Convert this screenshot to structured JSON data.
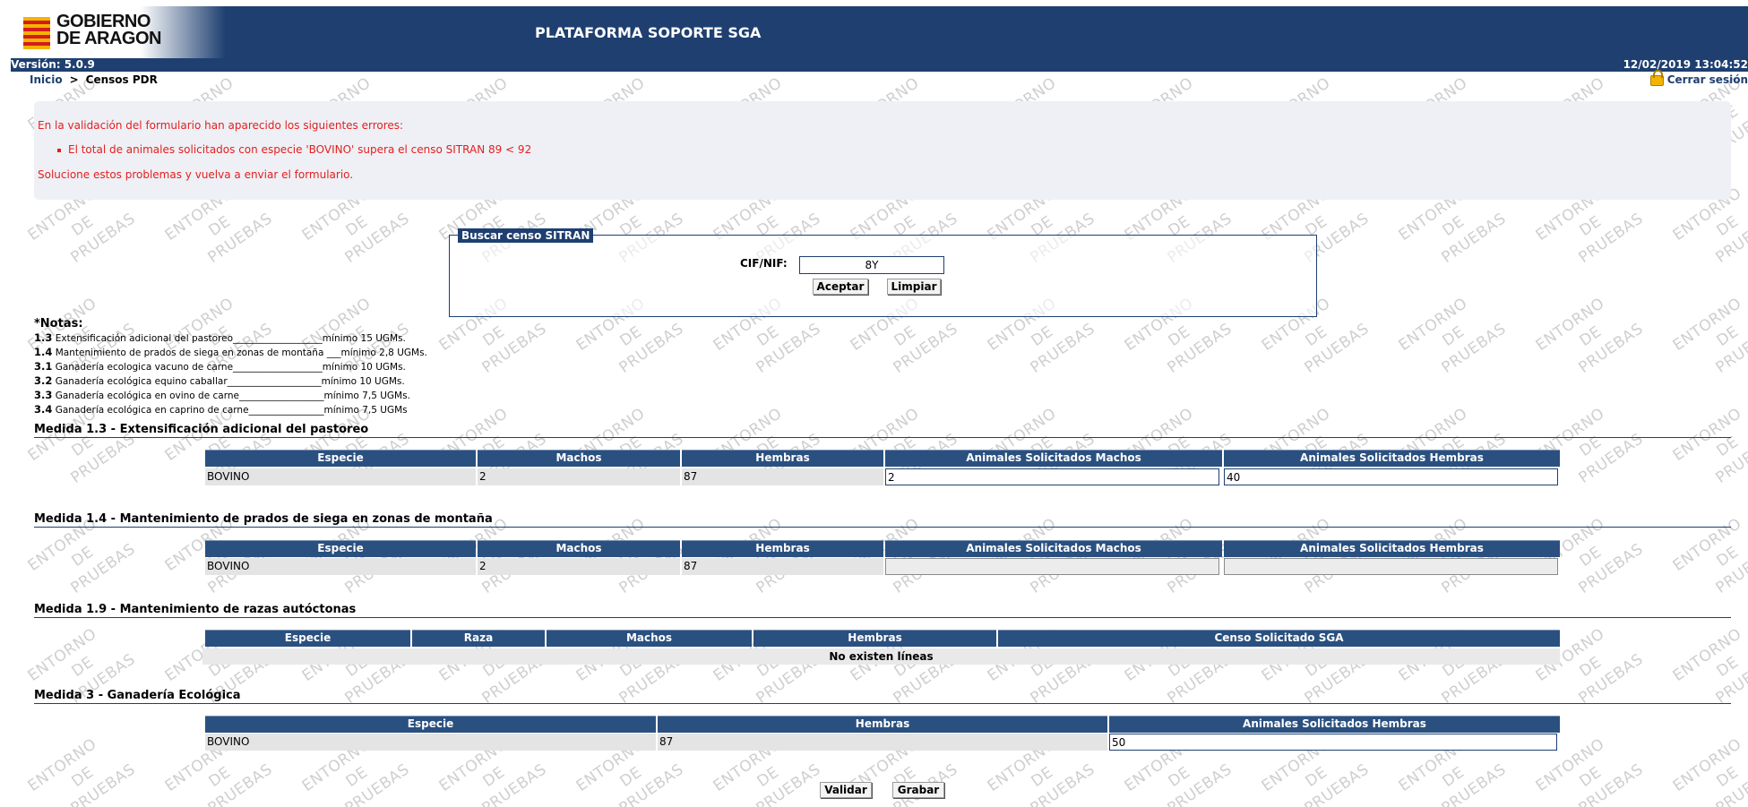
{
  "header": {
    "logo": "GOBIERNO DE ARAGON",
    "title": "PLATAFORMA SOPORTE SGA",
    "version": "Versión: 5.0.9",
    "datetime": "12/02/2019 13:04:52"
  },
  "breadcrumb": {
    "home": "Inicio",
    "separator": ">",
    "current": "Censos PDR"
  },
  "logout": "Cerrar sesión",
  "errors": {
    "intro": "En la validación del formulario han aparecido los siguientes errores:",
    "items": [
      "El total de animales solicitados con especie 'BOVINO' supera el censo SITRAN 89 < 92"
    ],
    "footer": "Solucione estos problemas y vuelva a enviar el formulario."
  },
  "search": {
    "legend": "Buscar censo SITRAN",
    "label": "CIF/NIF:",
    "value": "8Y",
    "accept": "Aceptar",
    "clear": "Limpiar"
  },
  "notes": {
    "title": "*Notas:",
    "items": [
      {
        "code": "1.3",
        "text": "Extensificación adicional del pastoreo___________________mínimo 15 UGMs."
      },
      {
        "code": "1.4",
        "text": "Mantenimiento de prados de siega en zonas de montaña ___mínimo 2,8 UGMs."
      },
      {
        "code": "3.1",
        "text": "Ganadería ecologica vacuno de carne___________________mínimo 10 UGMs."
      },
      {
        "code": "3.2",
        "text": "Ganadería ecológica equino caballar____________________mínimo 10 UGMs."
      },
      {
        "code": "3.3",
        "text": "Ganadería ecológica en ovino de carne__________________mínimo 7,5 UGMs."
      },
      {
        "code": "3.4",
        "text": "Ganadería ecológica en caprino de carne________________mínimo 7,5 UGMs"
      }
    ]
  },
  "s13": {
    "title": "Medida 1.3 - Extensificación adicional del pastoreo",
    "headers": [
      "Especie",
      "Machos",
      "Hembras",
      "Animales Solicitados Machos",
      "Animales Solicitados Hembras"
    ],
    "row": {
      "especie": "BOVINO",
      "machos": "2",
      "hembras": "87",
      "sol_machos": "2",
      "sol_hembras": "40"
    }
  },
  "s14": {
    "title": "Medida 1.4 - Mantenimiento de prados de siega en zonas de montaña",
    "headers": [
      "Especie",
      "Machos",
      "Hembras",
      "Animales Solicitados Machos",
      "Animales Solicitados Hembras"
    ],
    "row": {
      "especie": "BOVINO",
      "machos": "2",
      "hembras": "87",
      "sol_machos": "",
      "sol_hembras": ""
    }
  },
  "s19": {
    "title": "Medida 1.9 - Mantenimiento de razas autóctonas",
    "headers": [
      "Especie",
      "Raza",
      "Machos",
      "Hembras",
      "Censo Solicitado SGA"
    ],
    "empty": "No existen líneas"
  },
  "s3": {
    "title": "Medida 3 - Ganadería Ecológica",
    "headers": [
      "Especie",
      "Hembras",
      "Animales Solicitados Hembras"
    ],
    "row": {
      "especie": "BOVINO",
      "hembras": "87",
      "sol_hembras": "50"
    }
  },
  "actions": {
    "validate": "Validar",
    "save": "Grabar"
  },
  "watermark": [
    "ENTORNO",
    "DE",
    "PRUEBAS"
  ],
  "colors": {
    "header": "#1e3f70",
    "table_header": "#2a5080",
    "error": "#e31f1f"
  }
}
